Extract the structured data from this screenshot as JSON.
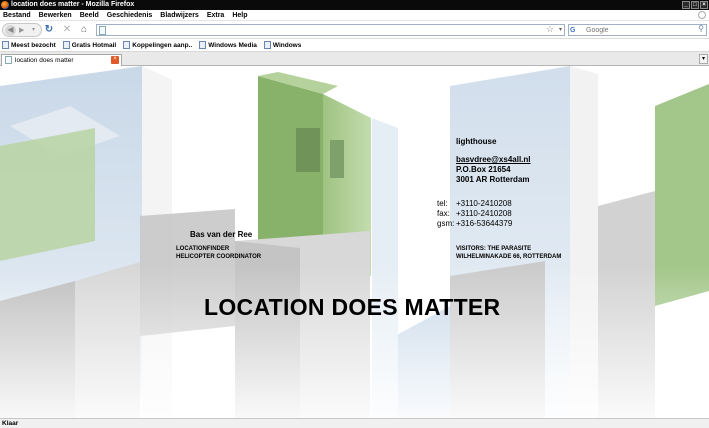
{
  "window": {
    "title": "location does matter - Mozilla Firefox",
    "controls": [
      "_",
      "□",
      "×"
    ]
  },
  "menu": {
    "items": [
      "Bestand",
      "Bewerken",
      "Beeld",
      "Geschiedenis",
      "Bladwijzers",
      "Extra",
      "Help"
    ]
  },
  "toolbar": {
    "back_glyph": "◀",
    "forward_glyph": "▶",
    "dropdown_glyph": "▾",
    "reload_glyph": "↻",
    "stop_glyph": "✕",
    "home_glyph": "⌂",
    "url": "",
    "star_glyph": "☆",
    "url_dropdown_glyph": "▾",
    "search_engine_label": "G",
    "search_placeholder": "Google",
    "search_icon_glyph": "⚲"
  },
  "bookmarks": {
    "items": [
      "Meest bezocht",
      "Gratis Hotmail",
      "Koppelingen aanp..",
      "Windows Media",
      "Windows"
    ]
  },
  "tabs": {
    "active_label": "location does matter",
    "close_glyph": "×",
    "list_glyph": "▾"
  },
  "page": {
    "person_name": "Bas van der Ree",
    "roles": [
      "LOCATIONFINDER",
      "HELICOPTER COORDINATOR"
    ],
    "company": "lighthouse",
    "email": "basvdree@xs4all.nl",
    "po_box": "P.O.Box 21654",
    "city": "3001 AR Rotterdam",
    "contact": [
      {
        "label": "tel:",
        "value": "+3110-2410208"
      },
      {
        "label": "fax:",
        "value": "+3110-2410208"
      },
      {
        "label": "gsm:",
        "value": "+316-53644379"
      }
    ],
    "visitors_title": "VISITORS: THE PARASITE",
    "visitors_address": "WILHELMINAKADE 66, ROTTERDAM",
    "headline": "LOCATION DOES MATTER"
  },
  "status": {
    "text": "Klaar"
  },
  "colors": {
    "building_green": "#a9c98f",
    "concrete": "#cfcfcf",
    "sky": "#b9cde0"
  }
}
